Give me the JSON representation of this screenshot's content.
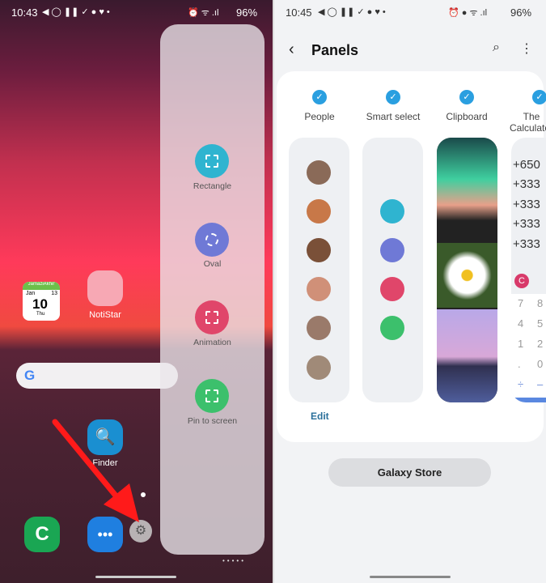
{
  "left": {
    "status": {
      "time": "10:43",
      "battery": "96%"
    },
    "panel_tools": [
      {
        "label": "Rectangle",
        "color": "#2fb4d0",
        "icon": "rectangle-select-icon"
      },
      {
        "label": "Oval",
        "color": "#6f79d6",
        "icon": "oval-select-icon"
      },
      {
        "label": "Animation",
        "color": "#e0466a",
        "icon": "gif-icon"
      },
      {
        "label": "Pin to screen",
        "color": "#3cc06c",
        "icon": "pin-icon"
      }
    ],
    "calendar": {
      "header": "JamaziAkhir",
      "month": "Jan",
      "day": "10",
      "weekday": "Thu",
      "hijri": "13"
    },
    "apps": {
      "notistar": "NotiStar",
      "finder": "Finder"
    },
    "arrow_color": "#ff1a1a"
  },
  "right": {
    "status": {
      "time": "10:45",
      "battery": "96%"
    },
    "header": {
      "title": "Panels"
    },
    "panels": [
      {
        "label": "People",
        "checked": true
      },
      {
        "label": "Smart select",
        "checked": true
      },
      {
        "label": "Clipboard",
        "checked": true
      },
      {
        "label": "The Calculator",
        "checked": true
      }
    ],
    "edit_label": "Edit",
    "calculator": {
      "lines": [
        "+650",
        "+333",
        "+333",
        "+333",
        "+333"
      ],
      "clear": "C",
      "keys": [
        [
          "7",
          "8"
        ],
        [
          "4",
          "5"
        ],
        [
          "1",
          "2"
        ],
        [
          ".",
          "0"
        ],
        [
          "÷",
          "–"
        ]
      ]
    },
    "galaxy_store_label": "Galaxy Store",
    "accent": "#2a9fe0"
  }
}
